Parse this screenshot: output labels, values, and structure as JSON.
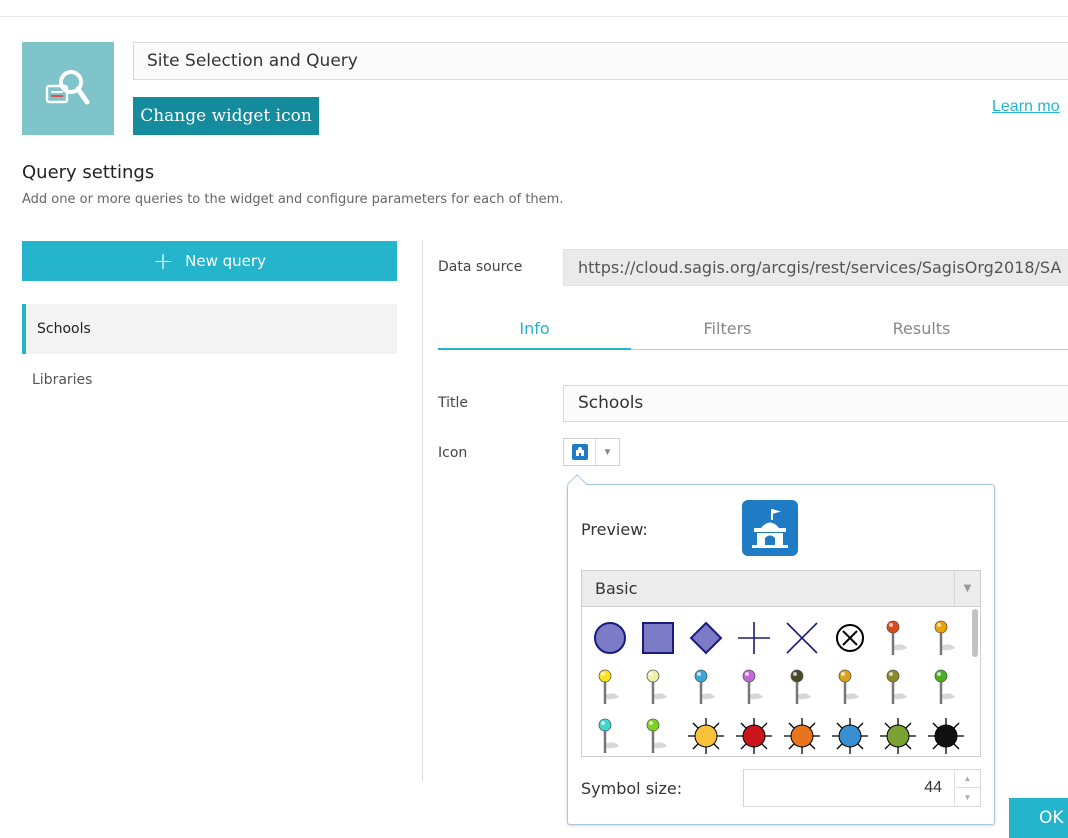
{
  "widget": {
    "name_value": "Site Selection and Query",
    "change_icon_label": "Change widget icon",
    "learn_more_label": "Learn mo"
  },
  "section": {
    "title": "Query settings",
    "description": "Add one or more queries to the widget and configure parameters for each of them."
  },
  "queries": {
    "new_query_label": "New query",
    "items": [
      {
        "label": "Schools",
        "active": true
      },
      {
        "label": "Libraries",
        "active": false
      }
    ]
  },
  "form": {
    "data_source_label": "Data source",
    "data_source_value": "https://cloud.sagis.org/arcgis/rest/services/SagisOrg2018/SA",
    "tabs": [
      {
        "label": "Info",
        "active": true
      },
      {
        "label": "Filters",
        "active": false
      },
      {
        "label": "Results",
        "active": false
      }
    ],
    "title_label": "Title",
    "title_value": "Schools",
    "icon_label": "Icon"
  },
  "symbol_picker": {
    "preview_label": "Preview:",
    "category_value": "Basic",
    "symbols": [
      "circle",
      "square",
      "diamond",
      "cross",
      "x",
      "circle-x",
      "pin-red-orange",
      "pin-orange",
      "pin-yellow",
      "pin-light-yellow",
      "pin-blue",
      "pin-purple",
      "pin-dark",
      "pin-gold",
      "pin-olive",
      "pin-green",
      "pin-cyan",
      "pin-lime",
      "sun-yellow",
      "sun-red",
      "sun-orange",
      "sun-blue",
      "sun-green",
      "sun-black"
    ],
    "symbol_size_label": "Symbol size:",
    "symbol_size_value": "44"
  },
  "footer": {
    "ok_label": "OK"
  },
  "colors": {
    "accent": "#24b5cc",
    "button_dark": "#158c9d",
    "widget_icon_bg": "#7fc3cb",
    "preview_icon_bg": "#1f7bc4",
    "symbol_fill": "#7b7bc6"
  }
}
